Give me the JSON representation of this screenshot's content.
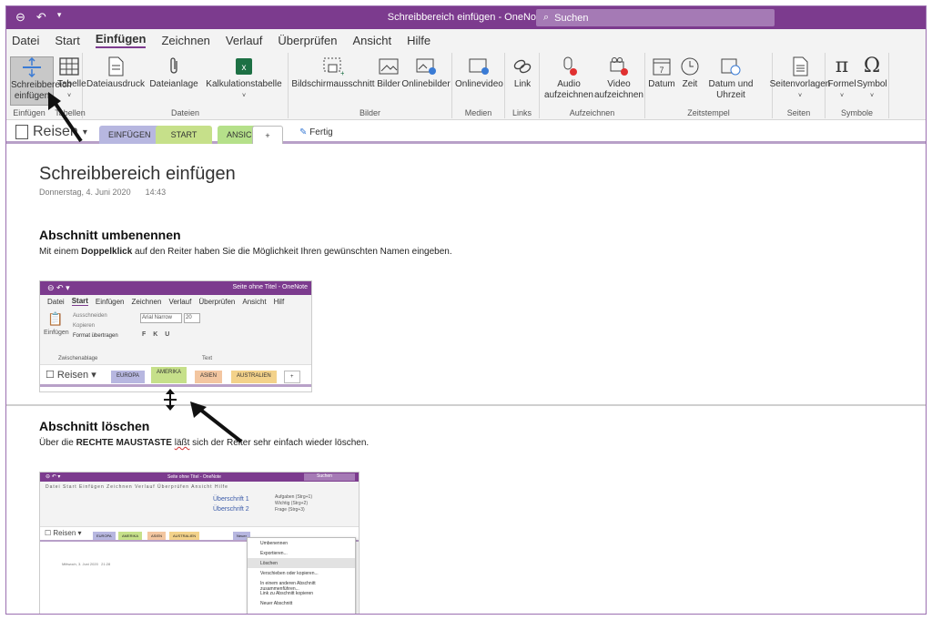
{
  "titlebar": {
    "title": "Schreibbereich einfügen - OneNote",
    "search_label": "Suchen",
    "back_icon": "back-icon",
    "undo_icon": "undo-icon"
  },
  "menu": [
    "Datei",
    "Start",
    "Einfügen",
    "Zeichnen",
    "Verlauf",
    "Überprüfen",
    "Ansicht",
    "Hilfe"
  ],
  "ribbon": {
    "groups": [
      {
        "label": "Einfügen",
        "buttons": [
          [
            "Schreibbereich",
            "einfügen"
          ]
        ]
      },
      {
        "label": "Tabellen",
        "buttons": [
          [
            "Tabelle",
            ""
          ]
        ]
      },
      {
        "label": "Dateien",
        "buttons": [
          [
            "Dateiausdruck",
            ""
          ],
          [
            "Dateianlage",
            ""
          ],
          [
            "Kalkulationstabelle",
            ""
          ]
        ]
      },
      {
        "label": "Bilder",
        "buttons": [
          [
            "Bildschirmausschnitt",
            ""
          ],
          [
            "Bilder",
            ""
          ],
          [
            "Onlinebilder",
            ""
          ]
        ]
      },
      {
        "label": "Medien",
        "buttons": [
          [
            "Onlinevideo",
            ""
          ]
        ]
      },
      {
        "label": "Links",
        "buttons": [
          [
            "Link",
            ""
          ]
        ]
      },
      {
        "label": "Aufzeichnen",
        "buttons": [
          [
            "Audio",
            "aufzeichnen"
          ],
          [
            "Video",
            "aufzeichnen"
          ]
        ]
      },
      {
        "label": "Zeitstempel",
        "buttons": [
          [
            "Datum",
            ""
          ],
          [
            "Zeit",
            ""
          ],
          [
            "Datum und",
            "Uhrzeit"
          ]
        ]
      },
      {
        "label": "Seiten",
        "buttons": [
          [
            "Seitenvorlagen",
            ""
          ]
        ]
      },
      {
        "label": "Symbole",
        "buttons": [
          [
            "Formel",
            ""
          ],
          [
            "Symbol",
            ""
          ]
        ]
      }
    ]
  },
  "notebook": {
    "name": "Reisen",
    "tabs": [
      "EINFÜGEN",
      "START",
      "ANSICHT",
      "+"
    ],
    "fertig": "Fertig"
  },
  "page": {
    "title": "Schreibbereich einfügen",
    "date": "Donnerstag, 4. Juni 2020",
    "time": "14:43",
    "section1": {
      "heading": "Abschnitt umbenennen",
      "text_a": "Mit einem ",
      "text_bold": "Doppelklick",
      "text_b": " auf den Reiter haben Sie die Möglichkeit Ihren gewünschten Namen eingeben."
    },
    "section2": {
      "heading": "Abschnitt löschen",
      "text_a": "Über die ",
      "text_bold": "RECHTE MAUSTASTE",
      "text_sq": "läßt",
      "text_b": " sich der Reiter sehr einfach wieder löschen."
    }
  },
  "shot1": {
    "title": "Seite ohne Titel - OneNote",
    "menu": [
      "Datei",
      "Start",
      "Einfügen",
      "Zeichnen",
      "Verlauf",
      "Überprüfen",
      "Ansicht",
      "Hilf"
    ],
    "clipboard": [
      "Ausschneiden",
      "Kopieren",
      "Format übertragen"
    ],
    "paste": "Einfügen",
    "font": "Arial Narrow",
    "size": "20",
    "group1": "Zwischenablage",
    "group2": "Text",
    "notebook": "Reisen",
    "tabs": [
      "EUROPA",
      "AMERIKA",
      "ASIEN",
      "AUSTRALIEN",
      "+"
    ]
  },
  "shot2": {
    "title": "Seite ohne Titel - OneNote",
    "search": "Suchen",
    "notebook": "Reisen",
    "tabs": [
      "EUROPA",
      "AMERIKA",
      "ASIEN",
      "AUSTRALIEN",
      "Neuer"
    ],
    "styles": [
      "Überschrift 1",
      "Überschrift 2"
    ],
    "tags": [
      "Aufgaben (Strg+1)",
      "Wichtig (Strg+2)",
      "Frage (Strg+3)"
    ],
    "date": "Mittwoch, 3. Juni 2020",
    "time": "21:28",
    "context_menu": [
      "Umbenennen",
      "Exportieren...",
      "Löschen",
      "Verschieben oder kopieren...",
      "In einem anderen Abschnitt zusammenführen...",
      "Link zu Abschnitt kopieren",
      "Neuer Abschnitt"
    ]
  }
}
